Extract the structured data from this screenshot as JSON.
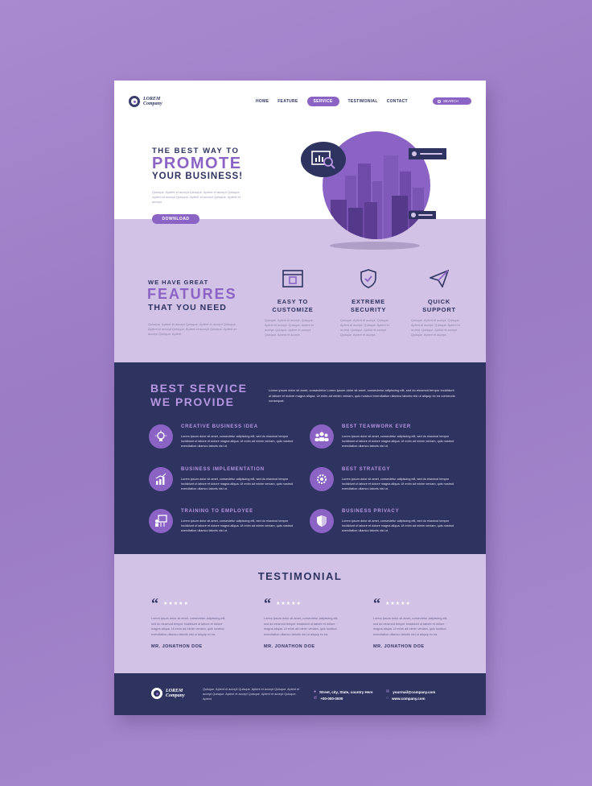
{
  "brand": {
    "logo_line1": "LOREM",
    "logo_line2": "Company"
  },
  "nav": {
    "items": [
      "HOME",
      "FEATURE",
      "SERVICE",
      "TESTIMONIAL",
      "CONTACT"
    ],
    "active": "SERVICE",
    "search_label": "SEARCH"
  },
  "hero": {
    "line1": "THE BEST WAY TO",
    "line2": "PROMOTE",
    "line3": "YOUR BUSINESS!",
    "body": "Quisque. Aptent et accept Quisque. Aptent et accept Quisque. Aptent et accept Quisque. Aptent et accept Quisque. Aptent et accept",
    "button": "DOWNLOAD"
  },
  "features": {
    "line1": "WE HAVE GREAT",
    "line2": "FEATURES",
    "line3": "THAT YOU NEED",
    "body": "Quisque. Aptent et accept Quisque. Aptent et accept Quisque. Aptent et accept Quisque. Aptent et accept Quisque. Aptent et accept Quisque. Aptent",
    "items": [
      {
        "icon": "browser-box-icon",
        "title_1": "EASY TO",
        "title_2": "CUSTOMIZE",
        "body": "Quisque. Aptent et accept. Quisque. Aptent et accept. Quisque. Aptent et accept. Quisque. Aptent et accept. Quisque. Aptent et accept."
      },
      {
        "icon": "shield-check-icon",
        "title_1": "EXTREME",
        "title_2": "SECURITY",
        "body": "Quisque. Aptent et accept. Quisque. Aptent et accept. Quisque. Aptent et accept. Quisque. Aptent et accept. Quisque. Aptent et accept."
      },
      {
        "icon": "paper-plane-icon",
        "title_1": "QUICK",
        "title_2": "SUPPORT",
        "body": "Quisque. Aptent et accept. Quisque. Aptent et accept. Quisque. Aptent et accept. Quisque. Aptent et accept. Quisque. Aptent et accept."
      }
    ]
  },
  "services": {
    "title_1": "BEST SERVICE",
    "title_2": "WE PROVIDE",
    "intro": "Lorem ipsum dolor sit amet, consectetur   Lorem ipsum dolor sit amet, consectetur adipiscing elit, sed do eiusmod tempor incididunt ut labore et dolore magna aliqua. Ut enim ad minim veniam, quis nostrud exercitation ullamco laboris nisi ut aliquip ex ea commodo consequat.",
    "items": [
      {
        "icon": "lightbulb-icon",
        "title": "CREATIVE BUSINESS IDEA",
        "body": "Lorem ipsum dolor sit amet, consectetur adipiscing elit, sed do eiusmod tempor incididunt ut labore et dolore magna aliqua. Ut enim ad minim veniam, quis nostrud exercitation ullamco laboris nisi ut."
      },
      {
        "icon": "team-icon",
        "title": "BEST TEAMWORK EVER",
        "body": "Lorem ipsum dolor sit amet, consectetur adipiscing elit, sed do eiusmod tempor incididunt ut labore et dolore magna aliqua. Ut enim ad minim veniam, quis nostrud exercitation ullamco laboris nisi ut."
      },
      {
        "icon": "growth-chart-icon",
        "title": "BUSINESS IMPLEMENTATION",
        "body": "Lorem ipsum dolor sit amet, consectetur adipiscing elit, sed do eiusmod tempor incididunt ut labore et dolore magna aliqua. Ut enim ad minim veniam, quis nostrud exercitation ullamco laboris nisi ut."
      },
      {
        "icon": "strategy-gear-icon",
        "title": "BEST STRATEGY",
        "body": "Lorem ipsum dolor sit amet, consectetur adipiscing elit, sed do eiusmod tempor incididunt ut labore et dolore magna aliqua. Ut enim ad minim veniam, quis nostrud exercitation ullamco laboris nisi ut."
      },
      {
        "icon": "presentation-icon",
        "title": "TRAINING TO EMPLOYEE",
        "body": "Lorem ipsum dolor sit amet, consectetur adipiscing elit, sed do eiusmod tempor incididunt ut labore et dolore magna aliqua. Ut enim ad minim veniam, quis nostrud exercitation ullamco laboris nisi ut."
      },
      {
        "icon": "privacy-shield-icon",
        "title": "BUSINESS PRIVACY",
        "body": "Lorem ipsum dolor sit amet, consectetur adipiscing elit, sed do eiusmod tempor incididunt ut labore et dolore magna aliqua. Ut enim ad minim veniam, quis nostrud exercitation ullamco laboris nisi ut."
      }
    ]
  },
  "testimonial": {
    "title": "TESTIMONIAL",
    "cards": [
      {
        "quote": "“",
        "stars": "★★★★★",
        "body": "Lorem ipsum dolor sit amet, consectetur adipiscing elit, sed do eiusmod tempor incididunt ut labore et dolore magna aliqua. Ut enim ad minim veniam, quis nostrud exercitation ullamco laboris nisi ut aliquip ex ea.",
        "name": "MR. JONATHON DOE"
      },
      {
        "quote": "“",
        "stars": "★★★★★",
        "body": "Lorem ipsum dolor sit amet, consectetur adipiscing elit, sed do eiusmod tempor incididunt ut labore et dolore magna aliqua. Ut enim ad minim veniam, quis nostrud exercitation ullamco laboris nisi ut aliquip ex ea.",
        "name": "MR. JONATHON DOE"
      },
      {
        "quote": "“",
        "stars": "★★★★★",
        "body": "Lorem ipsum dolor sit amet, consectetur adipiscing elit, sed do eiusmod tempor incididunt ut labore et dolore magna aliqua. Ut enim ad minim veniam, quis nostrud exercitation ullamco laboris nisi ut aliquip ex ea.",
        "name": "MR. JONATHON DOE"
      }
    ]
  },
  "footer": {
    "logo_line1": "LOREM",
    "logo_line2": "Company",
    "about": "Quisque. Aptent et accept Quisque. Aptent et accept Quisque. Aptent et accept Quisque. Aptent et accept Quisque. Aptent et accept Quisque. Aptent",
    "address": "Street, city, State, country Here",
    "phone": "+00-000-0000",
    "email": "yourmail@company.com",
    "website": "www.company.com"
  },
  "colors": {
    "primary": "#8a63c4",
    "navy": "#2e3360",
    "lavender": "#d2c2e6",
    "background": "#a989cf"
  }
}
